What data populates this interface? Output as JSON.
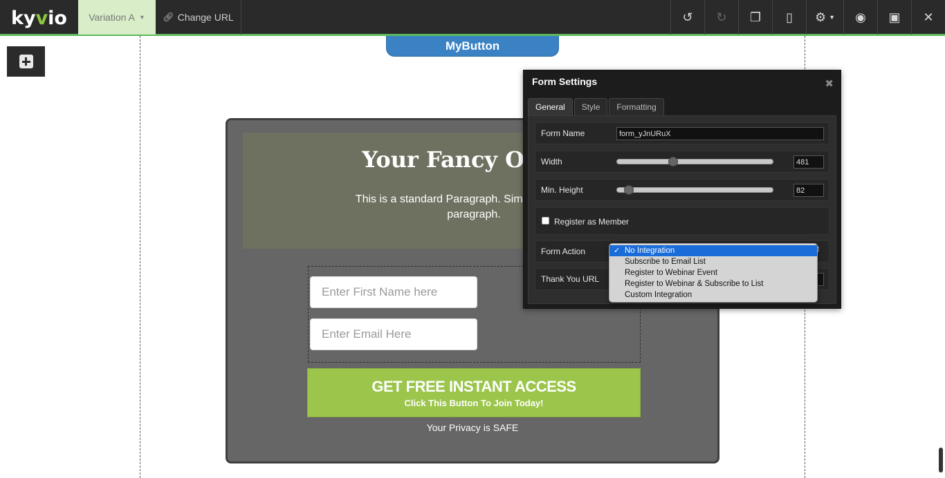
{
  "topbar": {
    "logo": {
      "prefix": "ky",
      "accent": "v",
      "suffix": "io"
    },
    "variation_label": "Variation A",
    "change_url_label": "Change URL",
    "tools": [
      {
        "name": "undo-icon",
        "glyph": "↺"
      },
      {
        "name": "redo-icon",
        "glyph": "↻"
      },
      {
        "name": "copy-icon",
        "glyph": "❐"
      },
      {
        "name": "mobile-icon",
        "glyph": "▯"
      },
      {
        "name": "gear-icon",
        "glyph": "⚙"
      },
      {
        "name": "eye-icon",
        "glyph": "👁"
      },
      {
        "name": "save-icon",
        "glyph": "💾"
      },
      {
        "name": "close-icon",
        "glyph": "✕"
      }
    ]
  },
  "canvas": {
    "mybutton_label": "MyButton",
    "optin": {
      "title": "Your Fancy Opt-In",
      "paragraph": "This is a standard Paragraph. Simply double clic\nparagraph.",
      "first_name_placeholder": "Enter First Name here",
      "email_placeholder": "Enter Email Here",
      "cta_main": "GET FREE INSTANT ACCESS",
      "cta_sub": "Click This Button To Join Today!",
      "privacy": "Your Privacy is SAFE"
    }
  },
  "dialog": {
    "title": "Form Settings",
    "tabs": [
      "General",
      "Style",
      "Formatting"
    ],
    "active_tab": "General",
    "form_name_label": "Form Name",
    "form_name_value": "form_yJnURuX",
    "width_label": "Width",
    "width_value": "481",
    "width_slider_fraction": 0.35,
    "min_height_label": "Min. Height",
    "min_height_value": "82",
    "min_height_slider_fraction": 0.05,
    "register_member_label": "Register as Member",
    "form_action_label": "Form Action",
    "thank_you_label": "Thank You URL",
    "form_action_options": [
      "No Integration",
      "Subscribe to Email List",
      "Register to Webinar Event",
      "Register to Webinar & Subscribe to List",
      "Custom Integration"
    ],
    "form_action_selected": "No Integration"
  },
  "colors": {
    "accent_green": "#5cb85c",
    "cta_green": "#9bc54b",
    "button_blue": "#3a82c4",
    "selected_blue": "#1a6cd9"
  }
}
